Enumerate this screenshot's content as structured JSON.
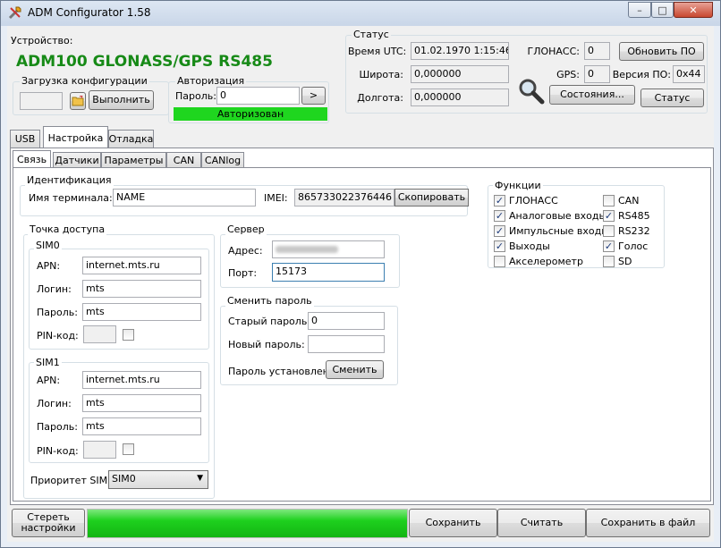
{
  "window": {
    "title": "ADM Configurator 1.58",
    "min_glyph": "–",
    "max_glyph": "□",
    "close_glyph": "✕"
  },
  "device": {
    "label": "Устройство:",
    "name": "ADM100 GLONASS/GPS RS485"
  },
  "config_load": {
    "title": "Загрузка конфигурации",
    "run_label": "Выполнить"
  },
  "auth": {
    "title": "Авторизация",
    "password_label": "Пароль:",
    "password_value": "0",
    "go_label": ">",
    "status": "Авторизован"
  },
  "status": {
    "title": "Статус",
    "utc_label": "Время UTC:",
    "utc_value": "01.02.1970 1:15:46",
    "lat_label": "Широта:",
    "lat_value": "0,000000",
    "lon_label": "Долгота:",
    "lon_value": "0,000000",
    "glonass_label": "ГЛОНАСС:",
    "glonass_value": "0",
    "gps_label": "GPS:",
    "gps_value": "0",
    "version_label": "Версия ПО:",
    "version_value": "0x44",
    "update_label": "Обновить ПО",
    "states_label": "Состояния...",
    "status_btn_label": "Статус"
  },
  "tabs": [
    "USB",
    "Настройка",
    "Отладка"
  ],
  "subtabs": [
    "Связь",
    "Датчики",
    "Параметры",
    "CAN",
    "CANlog"
  ],
  "ident": {
    "title": "Идентификация",
    "name_label": "Имя терминала:",
    "name_value": "NAME",
    "imei_label": "IMEI:",
    "imei_value": "865733022376446",
    "copy_label": "Скопировать"
  },
  "access_point": {
    "title": "Точка доступа",
    "sim0": {
      "title": "SIM0",
      "apn_label": "APN:",
      "apn_value": "internet.mts.ru",
      "login_label": "Логин:",
      "login_value": "mts",
      "password_label": "Пароль:",
      "password_value": "mts",
      "pin_label": "PIN-код:"
    },
    "sim1": {
      "title": "SIM1",
      "apn_label": "APN:",
      "apn_value": "internet.mts.ru",
      "login_label": "Логин:",
      "login_value": "mts",
      "password_label": "Пароль:",
      "password_value": "mts",
      "pin_label": "PIN-код:"
    },
    "priority_label": "Приоритет SIM:",
    "priority_value": "SIM0"
  },
  "server": {
    "title": "Сервер",
    "address_label": "Адрес:",
    "port_label": "Порт:",
    "port_value": "15173"
  },
  "change_password": {
    "title": "Сменить пароль",
    "old_label": "Старый пароль:",
    "old_value": "0",
    "new_label": "Новый пароль:",
    "new_value": "",
    "set_label": "Пароль установлен",
    "change_label": "Сменить"
  },
  "functions": {
    "title": "Функции",
    "left": [
      {
        "label": "ГЛОНАСС",
        "checked": true
      },
      {
        "label": "Аналоговые входы",
        "checked": true
      },
      {
        "label": "Импульсные входы",
        "checked": true
      },
      {
        "label": "Выходы",
        "checked": true
      },
      {
        "label": "Акселерометр",
        "checked": false
      }
    ],
    "right": [
      {
        "label": "CAN",
        "checked": false
      },
      {
        "label": "RS485",
        "checked": true
      },
      {
        "label": "RS232",
        "checked": false
      },
      {
        "label": "Голос",
        "checked": true
      },
      {
        "label": "SD",
        "checked": false
      }
    ]
  },
  "bottom": {
    "reset_label": "Стереть\nнастройки",
    "progress": 1.0,
    "save_label": "Сохранить",
    "read_label": "Считать",
    "save_file_label": "Сохранить в файл"
  },
  "colors": {
    "device_name": "#178a17",
    "auth_ok": "#1fd61f",
    "progress": "#1ed01e",
    "title_bg": "#c9d6e8"
  }
}
